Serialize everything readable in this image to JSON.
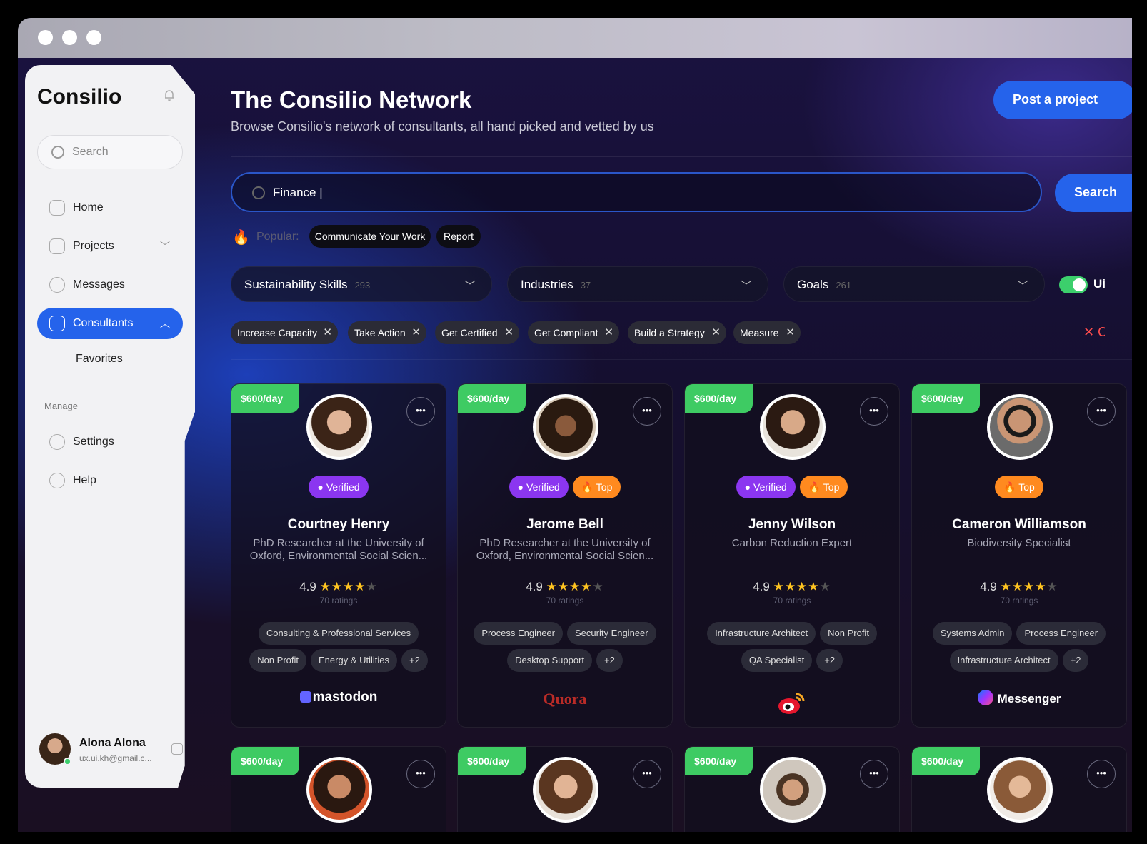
{
  "app": {
    "name": "Consilio"
  },
  "sidebar": {
    "search_placeholder": "Search",
    "nav": [
      {
        "label": "Home"
      },
      {
        "label": "Projects"
      },
      {
        "label": "Messages"
      },
      {
        "label": "Consultants"
      }
    ],
    "sub_item": "Favorites",
    "section_label": "Manage",
    "manage": [
      {
        "label": "Settings"
      },
      {
        "label": "Help"
      }
    ],
    "user": {
      "name": "Alona Alona",
      "email": "ux.ui.kh@gmail.c..."
    }
  },
  "header": {
    "title": "The Consilio Network",
    "subtitle": "Browse Consilio's network of consultants, all hand picked and vetted by us",
    "post_button": "Post a project"
  },
  "search": {
    "value": "Finance |",
    "button": "Search"
  },
  "popular": {
    "label": "Popular:",
    "chips": [
      "Communicate Your Work",
      "Report"
    ]
  },
  "filters": [
    {
      "label": "Sustainability Skills",
      "count": "293"
    },
    {
      "label": "Industries",
      "count": "37"
    },
    {
      "label": "Goals",
      "count": "261"
    }
  ],
  "toggle": {
    "label": "Ui",
    "on": true
  },
  "active_tags": [
    "Increase Capacity",
    "Take Action",
    "Get Certified",
    "Get Compliant",
    "Build a Strategy",
    "Measure"
  ],
  "clear_label": "✕ C",
  "colors": {
    "accent": "#2563eb",
    "price": "#3ecb63",
    "verified": "#8b36f0",
    "top": "#ff8a1f"
  },
  "consultants": [
    {
      "price": "$600/day",
      "verified": "Verified",
      "top": "",
      "name": "Courtney Henry",
      "role": "PhD Researcher at the University of Oxford, Environmental Social Scien...",
      "rating": "4.9",
      "ratings": "70 ratings",
      "skills": [
        "Consulting & Professional Services",
        "Non Profit",
        "Energy & Utilities",
        "+2"
      ],
      "brand": "mastodon",
      "brand_color": "#ffffff"
    },
    {
      "price": "$600/day",
      "verified": "Verified",
      "top": "Top",
      "name": "Jerome Bell",
      "role": "PhD Researcher at the University of Oxford, Environmental Social Scien...",
      "rating": "4.9",
      "ratings": "70 ratings",
      "skills": [
        "Process Engineer",
        "Security Engineer",
        "Desktop Support",
        "+2"
      ],
      "brand": "Quora",
      "brand_color": "#b92b27"
    },
    {
      "price": "$600/day",
      "verified": "Verified",
      "top": "Top",
      "name": "Jenny Wilson",
      "role": "Carbon Reduction Expert",
      "rating": "4.9",
      "ratings": "70 ratings",
      "skills": [
        "Infrastructure Architect",
        "Non Profit",
        "QA Specialist",
        "+2"
      ],
      "brand": "weibo-icon",
      "brand_color": "#e6162d"
    },
    {
      "price": "$600/day",
      "verified": "",
      "top": "Top",
      "name": "Cameron Williamson",
      "role": "Biodiversity Specialist",
      "rating": "4.9",
      "ratings": "70 ratings",
      "skills": [
        "Systems Admin",
        "Process Engineer",
        "Infrastructure Architect",
        "+2"
      ],
      "brand": "Messenger",
      "brand_color": "#ffffff"
    },
    {
      "price": "$600/day"
    },
    {
      "price": "$600/day"
    },
    {
      "price": "$600/day"
    },
    {
      "price": "$600/day"
    }
  ]
}
